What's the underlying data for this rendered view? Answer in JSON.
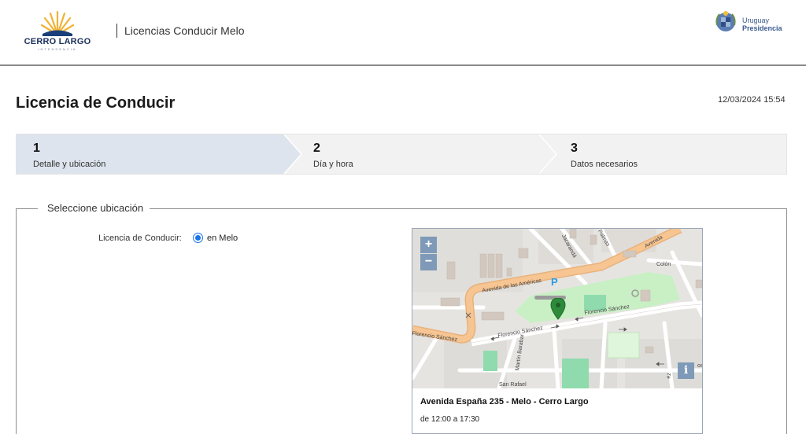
{
  "header": {
    "logo_text": "CERRO LARGO",
    "logo_subtext": "INTENDENCIA",
    "app_title": "Licencias Conducir Melo",
    "gov_line1": "Uruguay",
    "gov_line2": "Presidencia"
  },
  "page": {
    "title": "Licencia de Conducir",
    "datetime": "12/03/2024 15:54"
  },
  "wizard": {
    "steps": [
      {
        "number": "1",
        "label": "Detalle y ubicación",
        "active": true
      },
      {
        "number": "2",
        "label": "Día y hora",
        "active": false
      },
      {
        "number": "3",
        "label": "Datos necesarios",
        "active": false
      }
    ]
  },
  "location": {
    "legend": "Seleccione ubicación",
    "field_label": "Licencia de Conducir:",
    "option_label": "en Melo",
    "option_selected": true
  },
  "map": {
    "zoom_in": "+",
    "zoom_out": "−",
    "info": "i",
    "address": "Avenida España 235 - Melo - Cerro Largo",
    "hours": "de 12:00 a 17:30",
    "street_labels": {
      "americas": "Avenida de las Américas",
      "florencio_right": "Florencio Sánchez",
      "florencio_mid": "Florencio Sánchez",
      "florencio_left": "Florencio Sánchez",
      "colon": "Colón",
      "jacaranda": "Jacarandá",
      "palmas": "Palmas",
      "avenida": "Avenida",
      "martin": "Martín Barabar",
      "san_rafael": "San Rafael",
      "parking": "P",
      "fragment_os": "os",
      "fragment_ez": "ez"
    },
    "colors": {
      "marker": "#2e8b3a",
      "park": "#c8eec4",
      "road": "#f5c08a"
    }
  }
}
